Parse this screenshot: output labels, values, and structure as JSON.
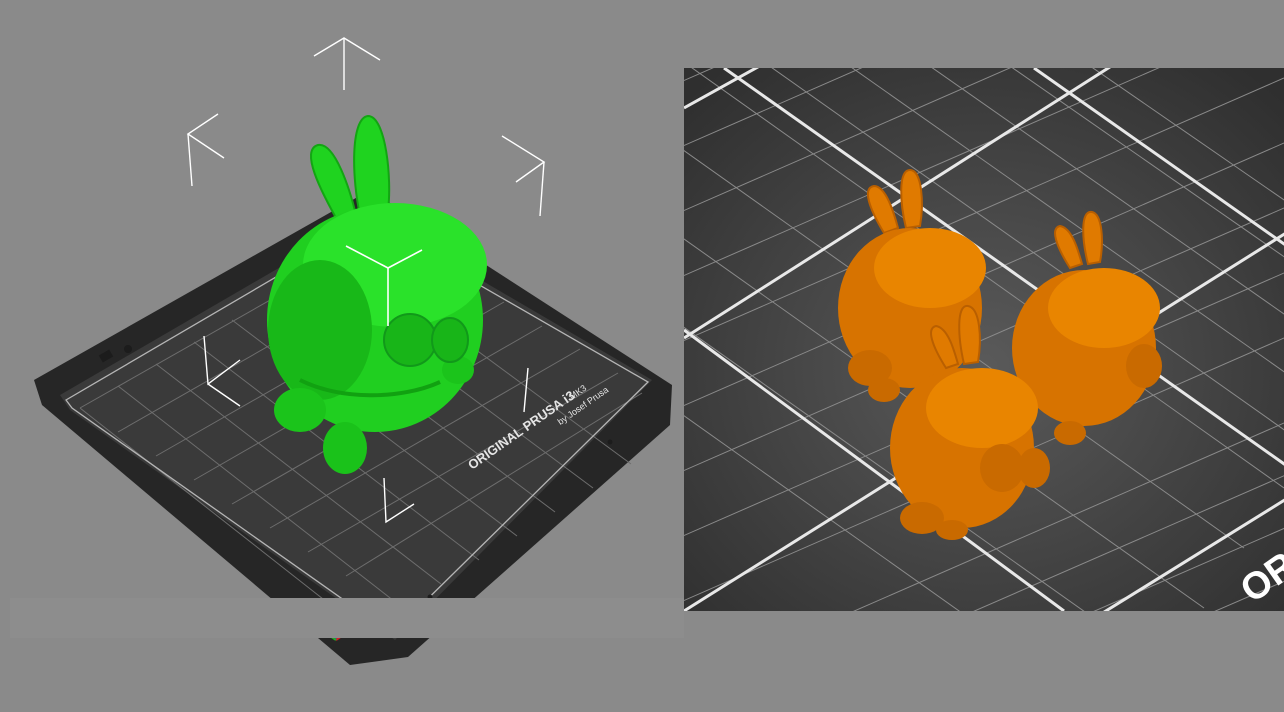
{
  "left_viewport": {
    "bed_label_main": "ORIGINAL PRUSA i3",
    "bed_label_model": "MK3",
    "bed_label_by": "by Josef Prusa",
    "model_color": "#1fd31f",
    "bed_color": "#2b2b2b"
  },
  "right_viewport": {
    "bed_label_fragment": "OR",
    "model_color": "#e07a00",
    "instance_count": 3
  },
  "icons": {
    "axes": "xyz-axes-icon",
    "gizmo": "rotate-gizmo-icon"
  }
}
